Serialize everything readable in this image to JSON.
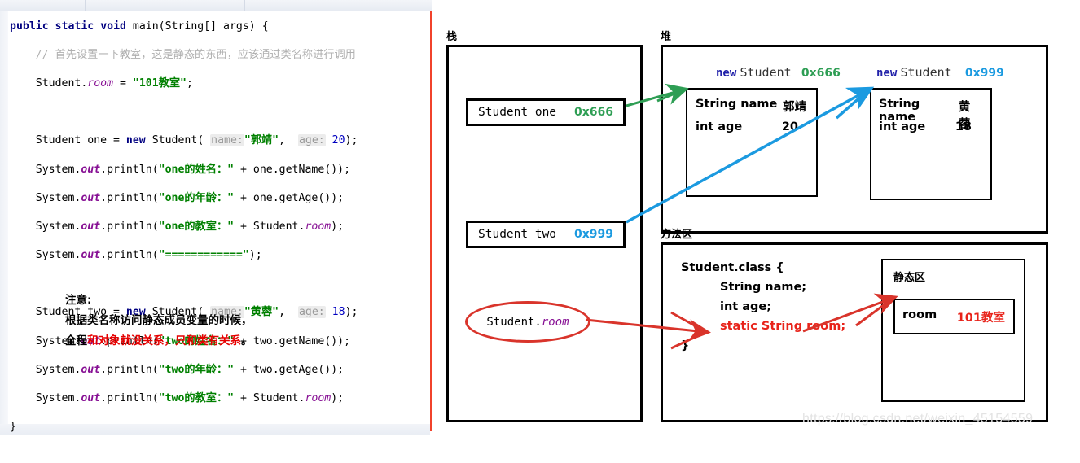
{
  "editor": {
    "lines": [
      "public static void main(String[] args) {",
      "    // 首先设置一下教室，这是静态的东西，应该通过类名称进行调用",
      "    Student.room = \"101教室\";",
      "",
      "    Student one = new Student( name: \"郭靖\",  age: 20);",
      "    System.out.println(\"one的姓名：\" + one.getName());",
      "    System.out.println(\"one的年龄：\" + one.getAge());",
      "    System.out.println(\"one的教室：\" + Student.room);",
      "    System.out.println(\"============\");",
      "",
      "    Student two = new Student( name: \"黄蓉\",  age: 18);",
      "    System.out.println(\"two的姓名：\" + two.getName());",
      "    System.out.println(\"two的年龄：\" + two.getAge());",
      "    System.out.println(\"two的教室：\" + Student.room);",
      "}"
    ],
    "tokens": {
      "kw_public": "public",
      "kw_static": "static",
      "kw_void": "void",
      "kw_new": "new",
      "main": " main(String[] args) {",
      "comment": "// 首先设置一下教室，这是静态的东西，应该通过类名称进行调用",
      "student": "Student",
      "dot": ".",
      "room": "room",
      "assign": " = ",
      "room_value": "\"101教室\"",
      "semi": ";",
      "var_one": " one = ",
      "var_two": " two = ",
      "ctor_open": " Student( ",
      "hint_name": "name:",
      "hint_age": "age:",
      "name_one": "\"郭靖\"",
      "name_two": "\"黄蓉\"",
      "age_one": "20",
      "age_two": "18",
      "ctor_close": ");",
      "sysout_pre": "System.",
      "out": "out",
      "println": ".println(",
      "plus": " + ",
      "close_paren": ");",
      "divider_str": "\"============\"",
      "brace_close": "}"
    },
    "print_lines": [
      {
        "str": "\"one的姓名：\"",
        "expr": "one.getName()",
        "tail": ");"
      },
      {
        "str": "\"one的年龄：\"",
        "expr": "one.getAge()",
        "tail": ");"
      },
      {
        "str": "\"one的教室：\"",
        "expr": "Student.",
        "field": "room",
        "tail": ");"
      },
      {
        "str": "\"two的姓名：\"",
        "expr": "two.getName()",
        "tail": ");"
      },
      {
        "str": "\"two的年龄：\"",
        "expr": "two.getAge()",
        "tail": ");"
      },
      {
        "str": "\"two的教室：\"",
        "expr": "Student.",
        "field": "room",
        "tail": ");"
      }
    ],
    "note": {
      "line1": "注意:",
      "line2": "根据类名称访问静态成员变量的时候，",
      "line3_black": "全程",
      "line3_red": "和对象就没关系，只和类有关系",
      "line3_end": "。"
    }
  },
  "diagram": {
    "stack": {
      "title": "栈",
      "vars": [
        {
          "name": "Student one",
          "addr": "0x666",
          "color": "#2e9e54"
        },
        {
          "name": "Student two",
          "addr": "0x999",
          "color": "#1b9ae0"
        }
      ],
      "annotation": {
        "prefix": "Student.",
        "field": "room"
      }
    },
    "heap": {
      "title": "堆",
      "objects": [
        {
          "new_kw": "new",
          "class_name": "Student",
          "addr": "0x666",
          "addr_color": "#2e9e54",
          "fields": [
            {
              "label": "String name",
              "value": "郭靖"
            },
            {
              "label": "int age",
              "value": "20"
            }
          ]
        },
        {
          "new_kw": "new",
          "class_name": "Student",
          "addr": "0x999",
          "addr_color": "#1b9ae0",
          "fields": [
            {
              "label": "String name",
              "value": "黄蓉"
            },
            {
              "label": "int age",
              "value": "18"
            }
          ]
        }
      ]
    },
    "method_area": {
      "title": "方法区",
      "class_decl": "Student.class {",
      "members": [
        {
          "text": "String name;",
          "red": false
        },
        {
          "text": "int age;",
          "red": false
        },
        {
          "text": "static String room;",
          "red": true
        }
      ],
      "class_close": "}",
      "static_area": {
        "title": "静态区",
        "entry": {
          "key": "room",
          "value": "101教室",
          "value_color": "#e8231a"
        }
      }
    },
    "arrows": {
      "one_to_obj1": {
        "color": "#2e9e54",
        "label": "stack-one-to-heap-object-1"
      },
      "two_to_obj2": {
        "color": "#1b9ae0",
        "label": "stack-two-to-heap-object-2"
      },
      "room_to_static": {
        "color": "#d9342b",
        "label": "static-field-to-static-area"
      },
      "ellipse_to_static": {
        "color": "#d9342b",
        "label": "student-room-to-static-field"
      }
    }
  },
  "watermark": "https://blog.csdn.net/weixin_45154559"
}
